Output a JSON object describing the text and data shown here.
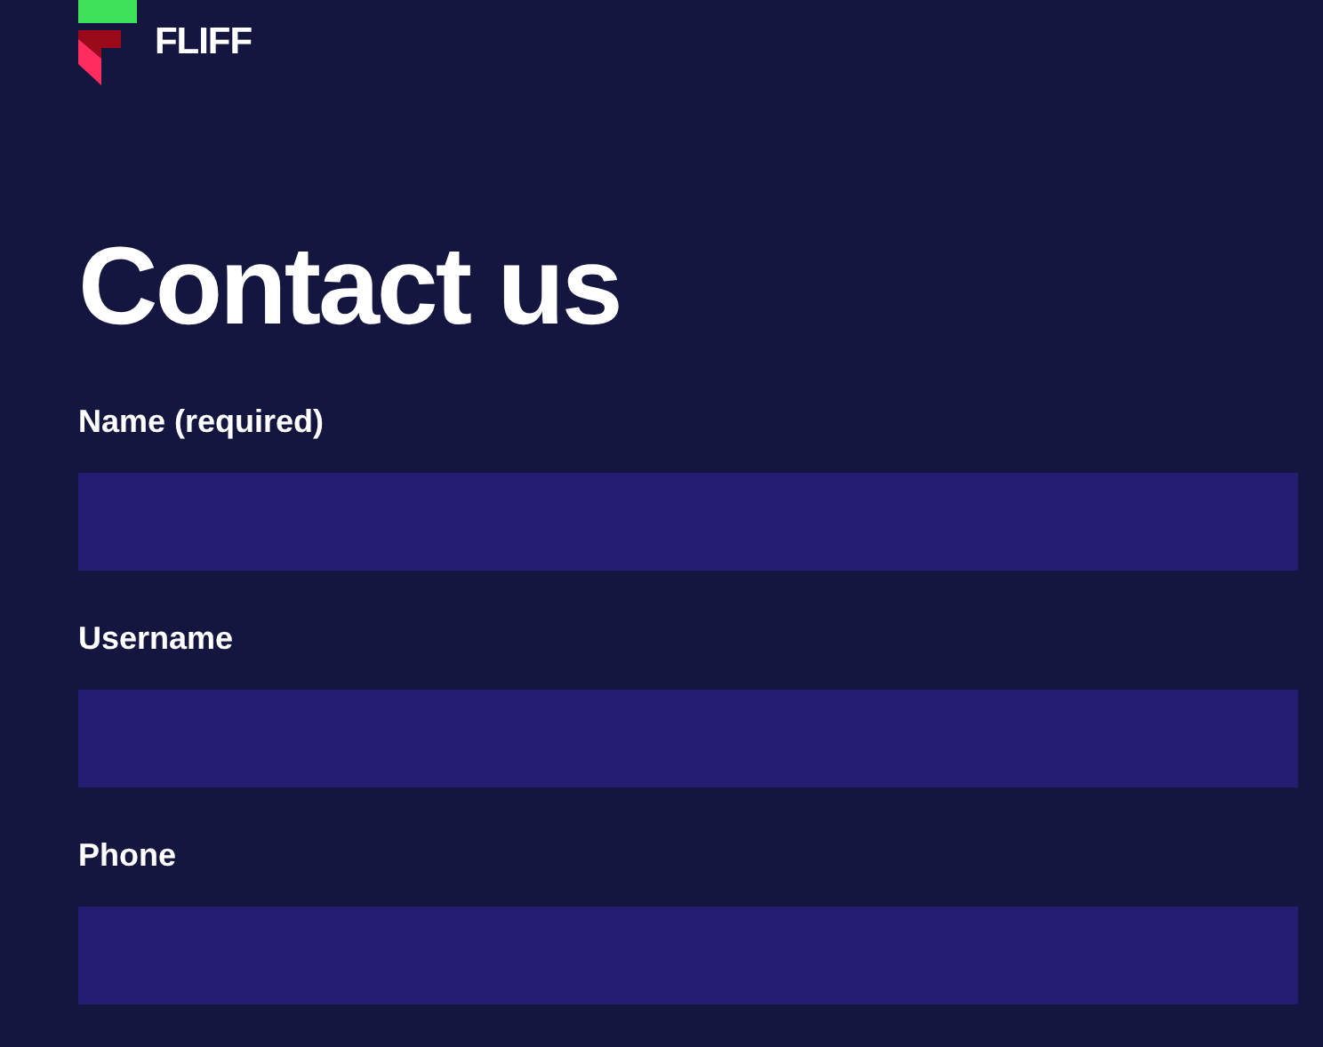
{
  "logo": {
    "text": "FLIFF"
  },
  "heading": "Contact us",
  "fields": [
    {
      "label": "Name (required)"
    },
    {
      "label": "Username"
    },
    {
      "label": "Phone"
    }
  ]
}
